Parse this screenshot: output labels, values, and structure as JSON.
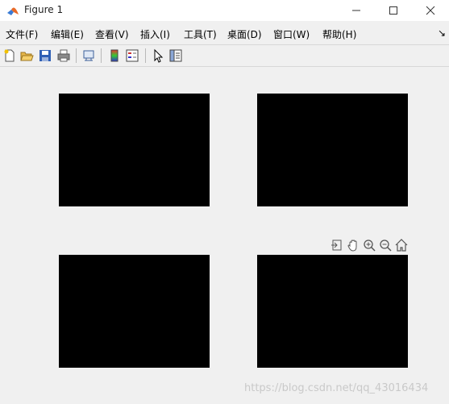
{
  "window": {
    "title": "Figure 1"
  },
  "menu": {
    "items": [
      "文件(F)",
      "编辑(E)",
      "查看(V)",
      "插入(I)",
      "工具(T)",
      "桌面(D)",
      "窗口(W)",
      "帮助(H)"
    ]
  },
  "toolbar": {
    "icons": [
      "new-figure-icon",
      "open-file-icon",
      "save-icon",
      "print-icon",
      "link-plot-icon",
      "insert-colorbar-icon",
      "insert-legend-icon",
      "edit-plot-icon",
      "property-inspector-icon"
    ]
  },
  "axes_toolbar": {
    "icons": [
      "export-icon",
      "pan-icon",
      "zoom-in-icon",
      "zoom-out-icon",
      "home-icon"
    ]
  },
  "images": [
    {
      "name": "color-image",
      "mode": "color"
    },
    {
      "name": "grayscale-image-1",
      "mode": "gray"
    },
    {
      "name": "grayscale-image-2",
      "mode": "gray-dark"
    },
    {
      "name": "grayscale-image-3",
      "mode": "gray-dark"
    }
  ],
  "watermark": "https://blog.csdn.net/qq_43016434",
  "colors": {
    "flamingo": "#f26a3c",
    "background": "#f0f0f0"
  }
}
